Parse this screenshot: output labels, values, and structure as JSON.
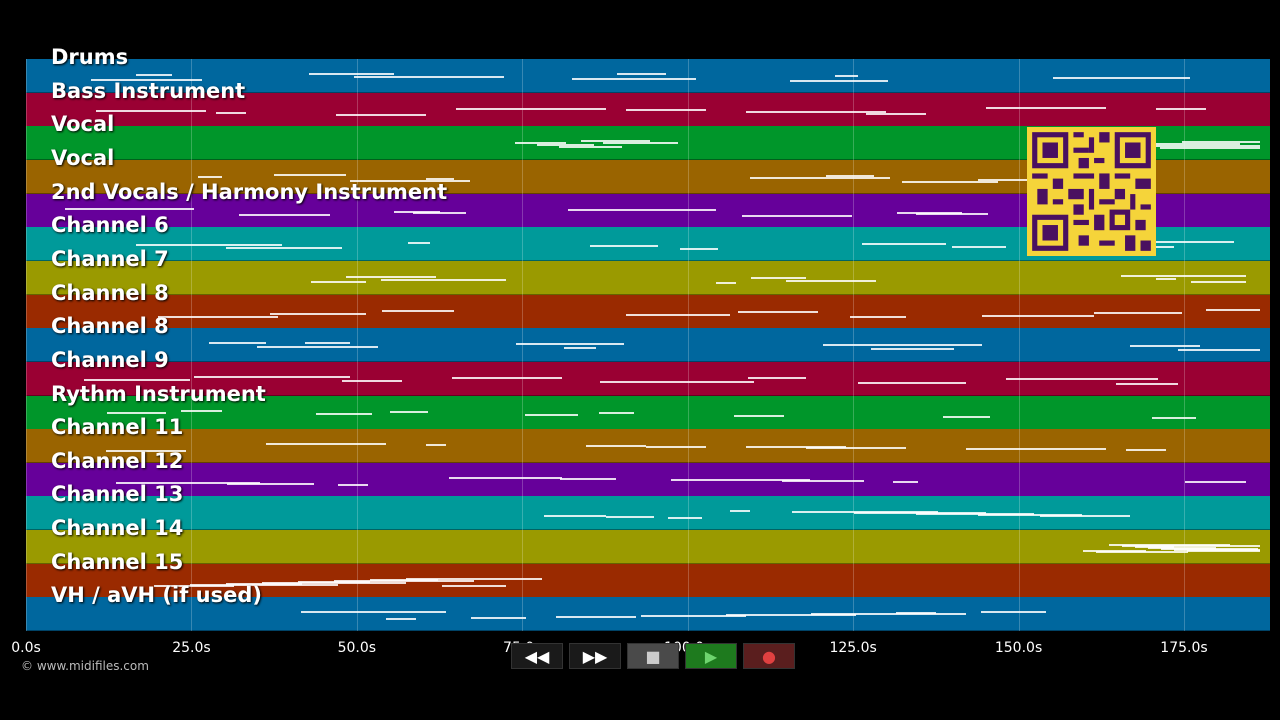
{
  "tracks": [
    {
      "name": "Drums",
      "color": "#00679e"
    },
    {
      "name": "Bass Instrument",
      "color": "#9a0033"
    },
    {
      "name": "Vocal",
      "color": "#00962a"
    },
    {
      "name": "Vocal",
      "color": "#9a6400"
    },
    {
      "name": "2nd Vocals / Harmony Instrument",
      "color": "#66009a"
    },
    {
      "name": "Channel 6",
      "color": "#009a9a"
    },
    {
      "name": "Channel 7",
      "color": "#9a9a00"
    },
    {
      "name": "Channel 8",
      "color": "#9a2a00"
    },
    {
      "name": "Channel 8",
      "color": "#00679e"
    },
    {
      "name": "Channel 9",
      "color": "#9a0033"
    },
    {
      "name": "Rythm Instrument",
      "color": "#00962a"
    },
    {
      "name": "Channel 11",
      "color": "#9a6400"
    },
    {
      "name": "Channel 12",
      "color": "#66009a"
    },
    {
      "name": "Channel 13",
      "color": "#009a9a"
    },
    {
      "name": "Channel 14",
      "color": "#9a9a00"
    },
    {
      "name": "Channel 15",
      "color": "#9a2a00"
    },
    {
      "name": "VH / aVH (if used)",
      "color": "#00679e"
    }
  ],
  "timeline": {
    "ticks": [
      "0.0s",
      "25.0s",
      "50.0s",
      "75.0s",
      "100.0s",
      "125.0s",
      "150.0s",
      "175.0s"
    ],
    "tick_seconds": [
      0,
      25,
      50,
      75,
      100,
      125,
      150,
      175
    ],
    "max_seconds": 188
  },
  "copyright": "© www.midifiles.com",
  "transport": {
    "rewind": "◀◀",
    "forward": "▶▶",
    "stop": "■",
    "play": "▶",
    "record": "●"
  },
  "qr_icon": "qr-code-icon"
}
